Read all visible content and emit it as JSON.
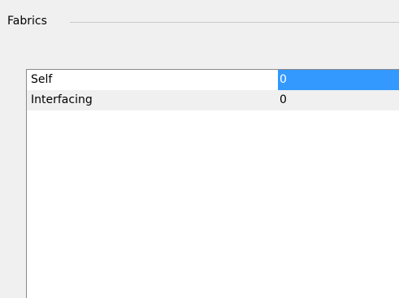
{
  "group": {
    "title": "Fabrics"
  },
  "grid": {
    "rows": [
      {
        "name": "Self",
        "value": "0",
        "selected": true
      },
      {
        "name": "Interfacing",
        "value": "0",
        "selected": false
      }
    ]
  },
  "colors": {
    "selection": "#3399ff",
    "alt_row": "#f0f0f0"
  }
}
